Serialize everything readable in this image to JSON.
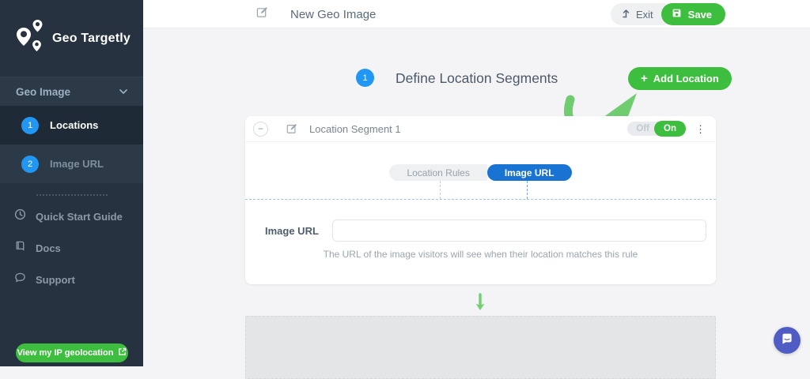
{
  "brand": {
    "name": "Geo Targetly"
  },
  "sidebar": {
    "section": {
      "label": "Geo Image"
    },
    "steps": [
      {
        "num": "1",
        "label": "Locations"
      },
      {
        "num": "2",
        "label": "Image URL"
      }
    ],
    "links": [
      {
        "label": "Quick Start Guide"
      },
      {
        "label": "Docs"
      },
      {
        "label": "Support"
      }
    ],
    "ip_button_label": "View my IP geolocation"
  },
  "header": {
    "title": "New Geo Image",
    "exit_label": "Exit",
    "save_label": "Save"
  },
  "main": {
    "step_badge": "1",
    "heading": "Define Location Segments",
    "add_location_label": "Add Location",
    "add_location_plus": "+"
  },
  "segment": {
    "collapse_glyph": "−",
    "title": "Location Segment 1",
    "toggle_off": "Off",
    "toggle_on": "On",
    "kebab_glyph": "⋮",
    "tabs": [
      {
        "label": "Location Rules"
      },
      {
        "label": "Image URL"
      }
    ],
    "field_label": "Image URL",
    "field_value": "",
    "helper_text": "The URL of the image visitors will see when their location matches this rule"
  },
  "colors": {
    "sidebar_dark": "#26323f",
    "sidebar_active": "#1e2a35",
    "accent_green": "#3ebe3e",
    "arrow_green": "#6fcd6f",
    "step_blue": "#2196f3",
    "tab_blue": "#1873d3",
    "intercom_indigo": "#4f5cc4"
  }
}
